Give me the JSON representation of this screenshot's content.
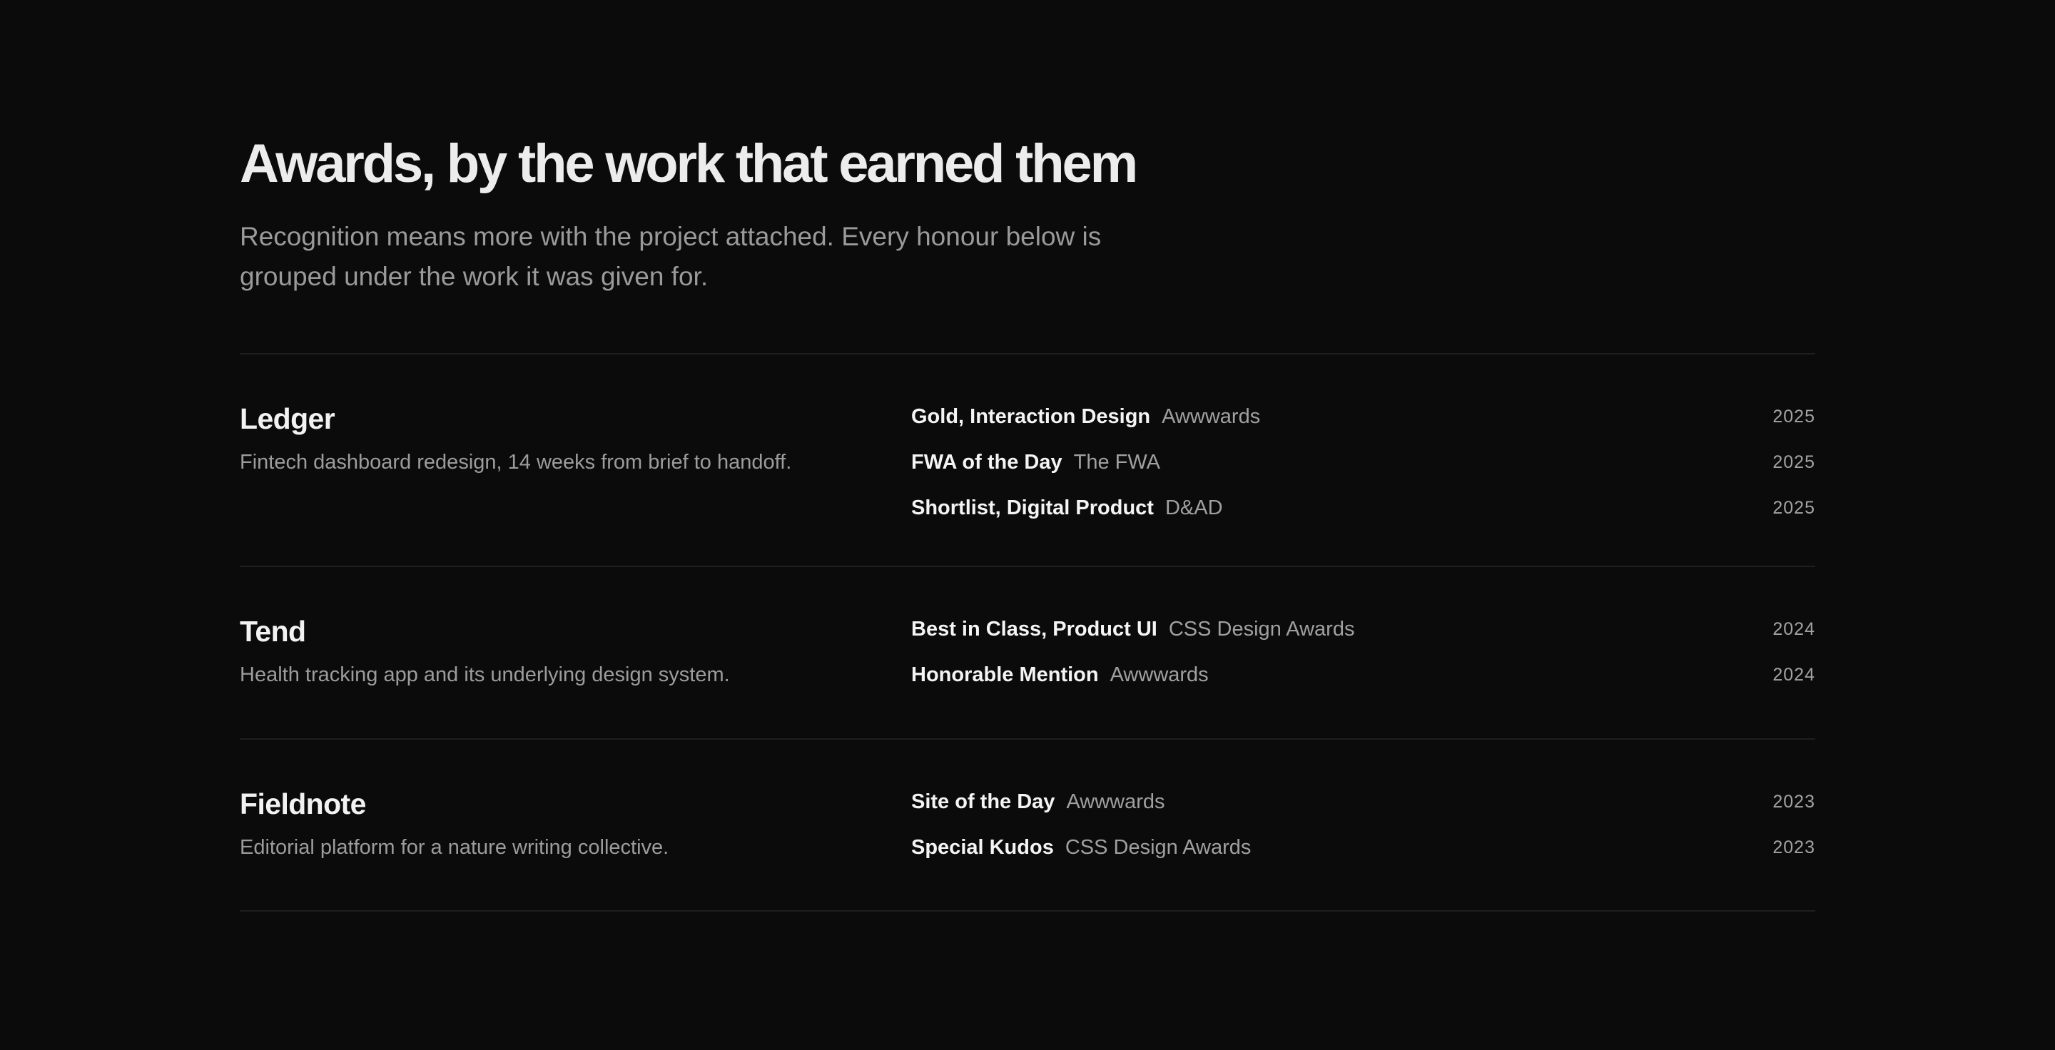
{
  "header": {
    "title": "Awards, by the work that earned them",
    "intro": "Recognition means more with the project attached. Every honour below is grouped under the work it was given for."
  },
  "projects": [
    {
      "name": "Ledger",
      "description": "Fintech dashboard redesign, 14 weeks from brief to handoff.",
      "awards": [
        {
          "title": "Gold, Interaction Design",
          "organization": "Awwwards",
          "year": "2025"
        },
        {
          "title": "FWA of the Day",
          "organization": "The FWA",
          "year": "2025"
        },
        {
          "title": "Shortlist, Digital Product",
          "organization": "D&AD",
          "year": "2025"
        }
      ]
    },
    {
      "name": "Tend",
      "description": "Health tracking app and its underlying design system.",
      "awards": [
        {
          "title": "Best in Class, Product UI",
          "organization": "CSS Design Awards",
          "year": "2024"
        },
        {
          "title": "Honorable Mention",
          "organization": "Awwwards",
          "year": "2024"
        }
      ]
    },
    {
      "name": "Fieldnote",
      "description": "Editorial platform for a nature writing collective.",
      "awards": [
        {
          "title": "Site of the Day",
          "organization": "Awwwards",
          "year": "2023"
        },
        {
          "title": "Special Kudos",
          "organization": "CSS Design Awards",
          "year": "2023"
        }
      ]
    }
  ],
  "colors": {
    "background": "#0b0b0b",
    "heading": "#ececec",
    "muted_text": "#9a9a9a",
    "divider": "#1f1f1f"
  }
}
